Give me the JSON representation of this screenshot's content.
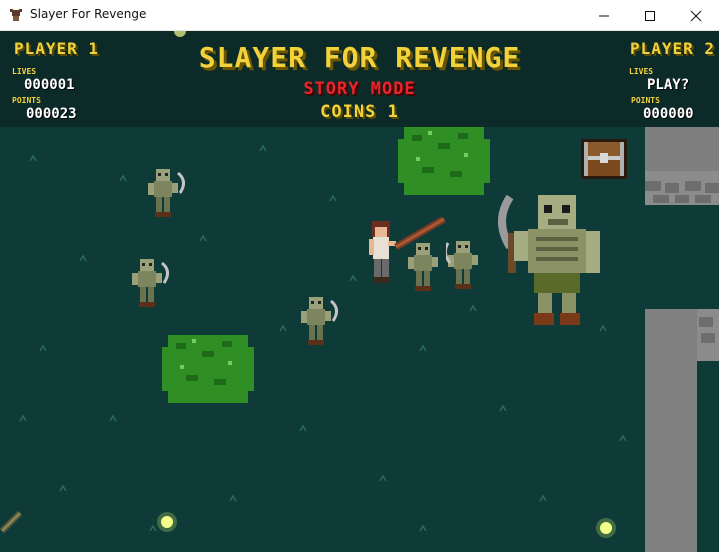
{
  "window": {
    "title": "Slayer For Revenge",
    "icons": {
      "app": "helmet-icon",
      "minimize": "minimize-icon",
      "maximize": "maximize-icon",
      "close": "close-icon"
    }
  },
  "hud": {
    "player1": {
      "title": "PLAYER 1",
      "lives_label": "LIVES",
      "lives": "000001",
      "points_label": "POINTS",
      "points": "000023"
    },
    "player2": {
      "title": "PLAYER 2",
      "lives_label": "LIVES",
      "lives": "PLAY?",
      "points_label": "POINTS",
      "points": "000000"
    },
    "game_title": "SLAYER FOR REVENGE",
    "mode": "STORY MODE",
    "coins_label": "COINS",
    "coins": "1"
  },
  "colors": {
    "background": "#0e3a38",
    "hud": "#0b2a28",
    "yellow": "#f2d23a",
    "red": "#e8262a",
    "wall": "#8a8a8a",
    "bush": "#2f8f24"
  },
  "scene": {
    "player": "hero-with-axe",
    "boss": "giant-skeleton-with-scythe",
    "enemies": [
      "skeleton",
      "skeleton",
      "skeleton",
      "skeleton",
      "skeleton"
    ],
    "objects": [
      "treasure-chest",
      "bush",
      "bush",
      "stone-wall",
      "glowing-orb",
      "glowing-orb",
      "dropped-weapon"
    ]
  }
}
